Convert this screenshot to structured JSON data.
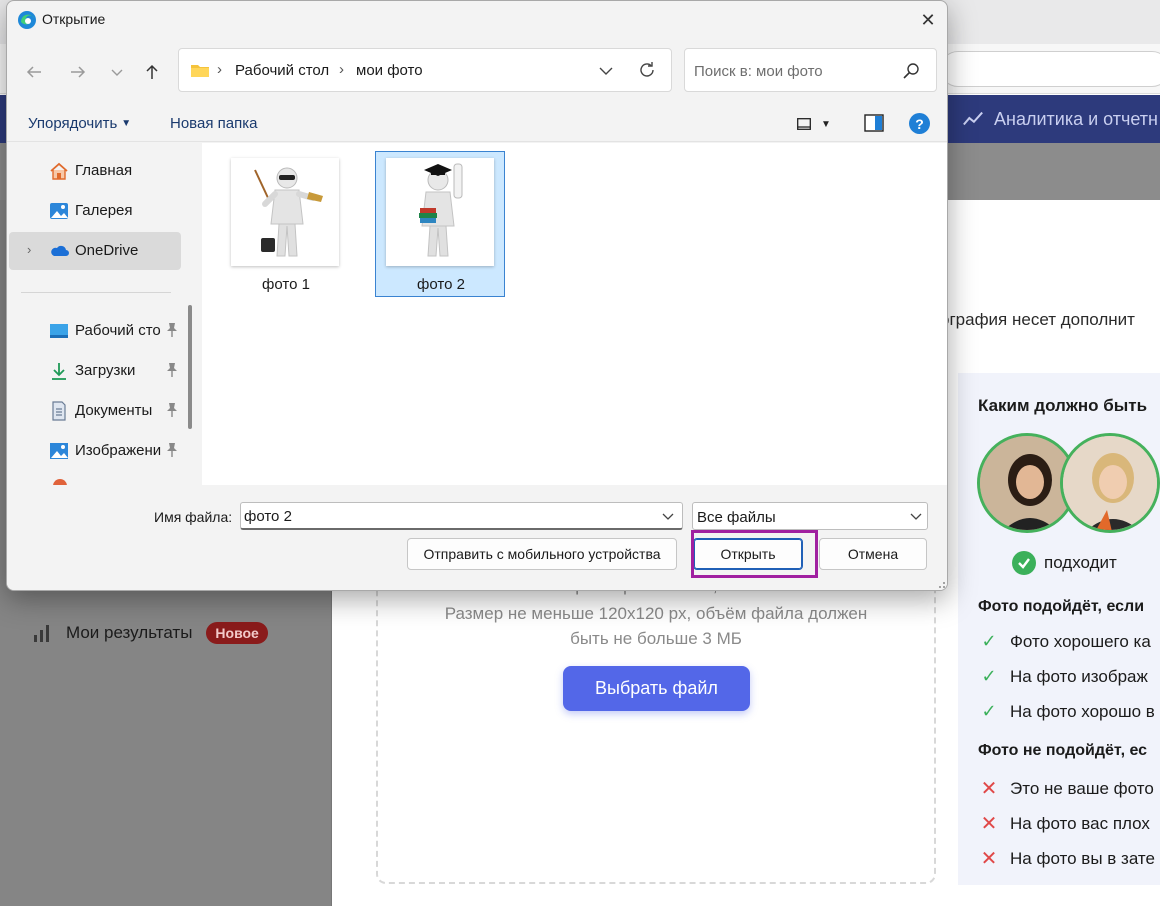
{
  "dialog": {
    "title": "Открытие",
    "close_glyph": "✕",
    "path": [
      "Рабочий стол",
      "мои фото"
    ],
    "path_separator": "›",
    "search_placeholder": "Поиск в: мои фото",
    "toolbar": {
      "organize": "Упорядочить",
      "new_folder": "Новая папка",
      "help": "?"
    },
    "nav": {
      "items": [
        {
          "label": "Главная",
          "icon": "home-icon"
        },
        {
          "label": "Галерея",
          "icon": "gallery-icon"
        },
        {
          "label": "OneDrive",
          "icon": "onedrive-icon",
          "selected": true,
          "expand": "›"
        },
        {
          "label": "Рабочий сто",
          "icon": "desktop-icon",
          "pinned": true
        },
        {
          "label": "Загрузки",
          "icon": "downloads-icon",
          "pinned": true
        },
        {
          "label": "Документы",
          "icon": "documents-icon",
          "pinned": true
        },
        {
          "label": "Изображени",
          "icon": "pictures-icon",
          "pinned": true
        }
      ]
    },
    "files": [
      {
        "name": "фото 1",
        "icon": "teacher-figure-thumbnail",
        "selected": false
      },
      {
        "name": "фото 2",
        "icon": "graduate-figure-thumbnail",
        "selected": true
      }
    ],
    "filename_label": "Имя файла:",
    "filename_value": "фото 2",
    "filter_value": "Все файлы",
    "buttons": {
      "mobile": "Отправить с мобильного устройства",
      "open": "Открыть",
      "cancel": "Отмена"
    }
  },
  "background": {
    "nav_analytics": "Аналитика и отчетн",
    "intro_text": "ография несет дополнит",
    "sidebar_results": "Мои результаты",
    "badge_new": "Новое",
    "upload": {
      "format_line": "Формат файла: JPG, PNG",
      "size_line1": "Размер не меньше 120х120 px, объём файла должен",
      "size_line2": "быть не больше 3 МБ",
      "choose_button": "Выбрать файл"
    },
    "requirements": {
      "title": "Каким должно быть",
      "suits_label": "подходит",
      "good_heading": "Фото подойдёт, если",
      "good_items": [
        "Фото хорошего ка",
        "На фото изображ",
        "На фото хорошо в"
      ],
      "bad_heading": "Фото не подойдёт, ес",
      "bad_items": [
        "Это не ваше фото",
        "На фото вас плох",
        "На фото вы в зате"
      ]
    }
  },
  "colors": {
    "accent_blue": "#5367e8",
    "header_navy": "#2d3a7c",
    "highlight_purple": "#a020a0",
    "success_green": "#3bb05a",
    "error_red": "#e04848",
    "selection_blue": "#cce8ff"
  }
}
